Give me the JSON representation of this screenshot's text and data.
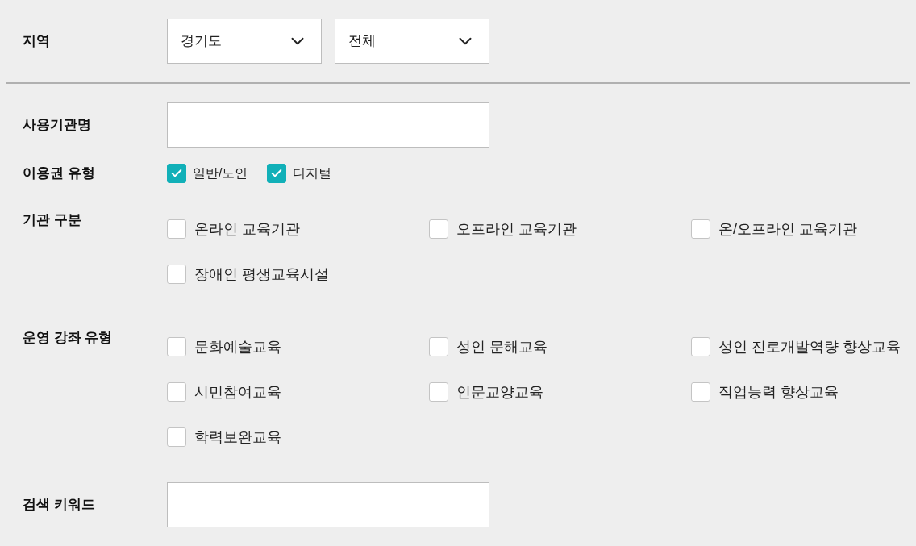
{
  "region": {
    "label": "지역",
    "selects": [
      {
        "value": "경기도"
      },
      {
        "value": "전체"
      }
    ]
  },
  "institution_name": {
    "label": "사용기관명"
  },
  "voucher_type": {
    "label": "이용권 유형",
    "options": [
      {
        "label": "일반/노인",
        "checked": true
      },
      {
        "label": "디지털",
        "checked": true
      }
    ]
  },
  "institution_category": {
    "label": "기관 구분",
    "options": [
      {
        "label": "온라인 교육기관",
        "checked": false
      },
      {
        "label": "오프라인 교육기관",
        "checked": false
      },
      {
        "label": "온/오프라인 교육기관",
        "checked": false
      },
      {
        "label": "장애인 평생교육시설",
        "checked": false
      }
    ]
  },
  "course_type": {
    "label": "운영 강좌 유형",
    "options": [
      {
        "label": "문화예술교육",
        "checked": false
      },
      {
        "label": "성인 문해교육",
        "checked": false
      },
      {
        "label": "성인 진로개발역량 향상교육",
        "checked": false
      },
      {
        "label": "시민참여교육",
        "checked": false
      },
      {
        "label": "인문교양교육",
        "checked": false
      },
      {
        "label": "직업능력 향상교육",
        "checked": false
      },
      {
        "label": "학력보완교육",
        "checked": false
      }
    ]
  },
  "keyword": {
    "label": "검색 키워드"
  }
}
